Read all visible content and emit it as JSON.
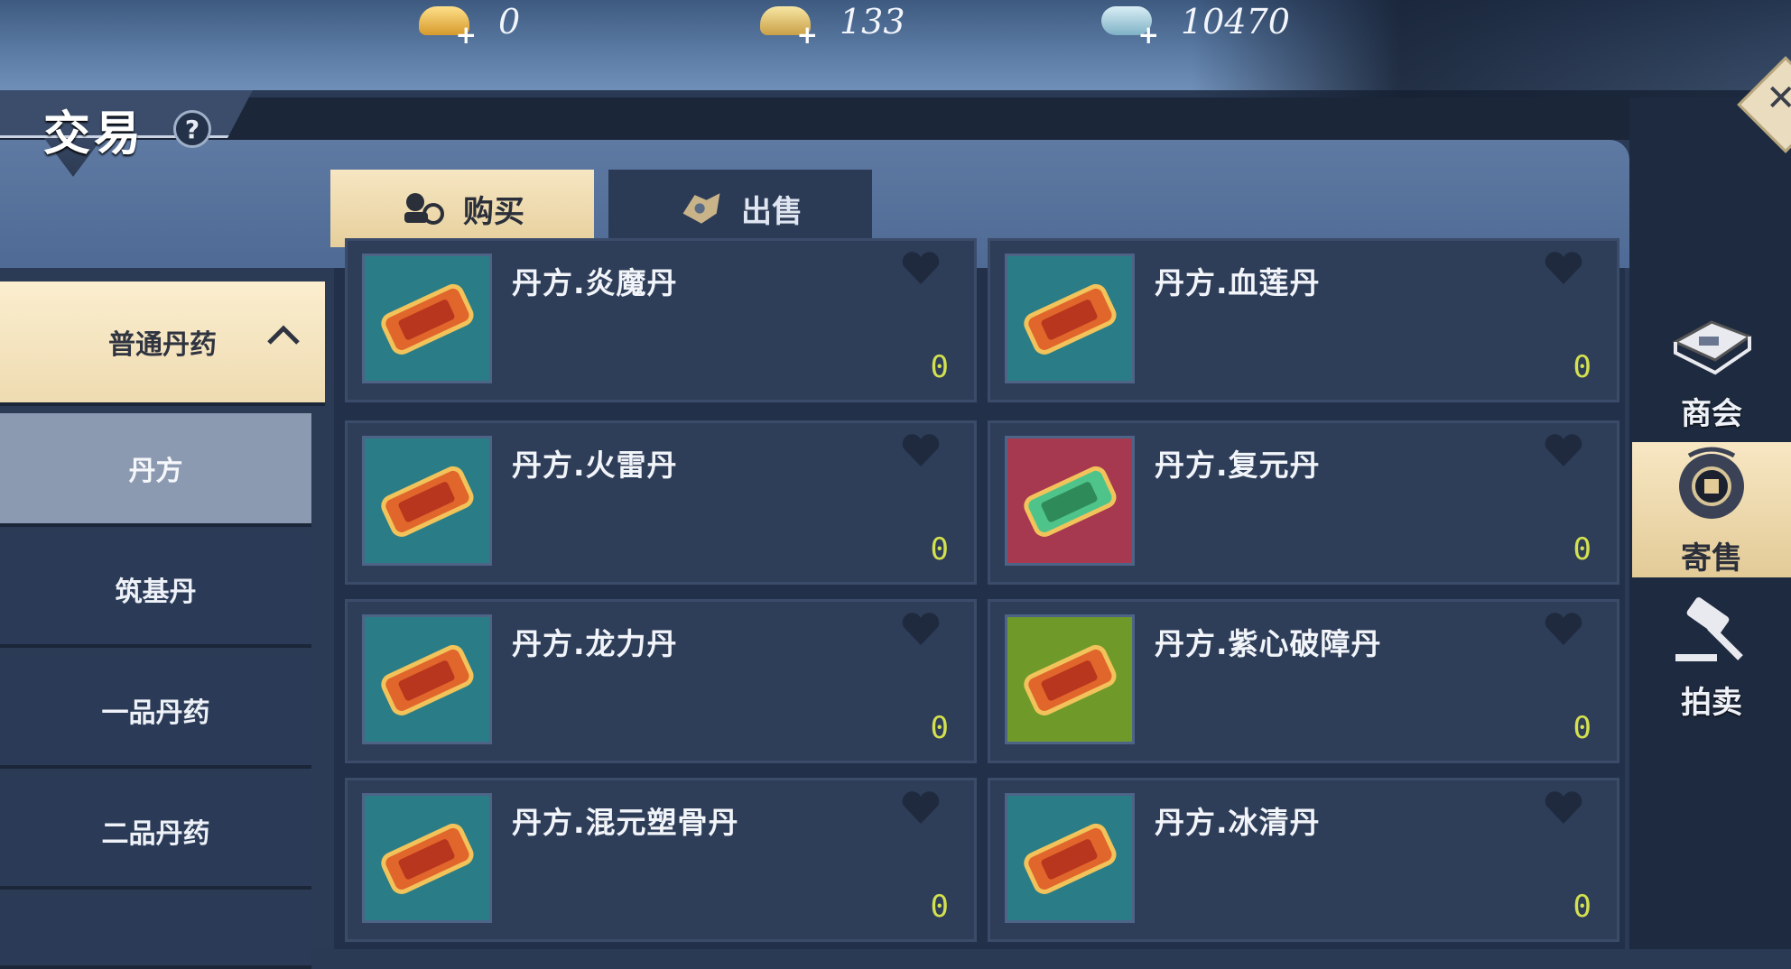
{
  "currencies": [
    {
      "icon": "gold-ingot-icon",
      "value": "0"
    },
    {
      "icon": "gold-ticket-icon",
      "value": "133"
    },
    {
      "icon": "silver-coin-icon",
      "value": "10470"
    }
  ],
  "header": {
    "title": "交易",
    "help": "?"
  },
  "tabs": [
    {
      "label": "购买",
      "icon": "buy-icon",
      "active": true
    },
    {
      "label": "出售",
      "icon": "sell-icon",
      "active": false
    }
  ],
  "categories": {
    "parent": "普通丹药",
    "items": [
      "丹方",
      "筑基丹",
      "一品丹药",
      "二品丹药"
    ]
  },
  "items": [
    {
      "name": "丹方.炎魔丹",
      "count": "0",
      "bg": "#2a7d86"
    },
    {
      "name": "丹方.血莲丹",
      "count": "0",
      "bg": "#2a7d86"
    },
    {
      "name": "丹方.火雷丹",
      "count": "0",
      "bg": "#2a7d86"
    },
    {
      "name": "丹方.复元丹",
      "count": "0",
      "bg": "#a6384f"
    },
    {
      "name": "丹方.龙力丹",
      "count": "0",
      "bg": "#2a7d86"
    },
    {
      "name": "丹方.紫心破障丹",
      "count": "0",
      "bg": "#6f9a2a"
    },
    {
      "name": "丹方.混元塑骨丹",
      "count": "0",
      "bg": "#2a7d86"
    },
    {
      "name": "丹方.冰清丹",
      "count": "0",
      "bg": "#2a7d86"
    }
  ],
  "side_nav": [
    {
      "label": "商会",
      "icon": "chamber-icon",
      "active": false
    },
    {
      "label": "寄售",
      "icon": "consign-icon",
      "active": true
    },
    {
      "label": "拍卖",
      "icon": "auction-icon",
      "active": false
    }
  ]
}
